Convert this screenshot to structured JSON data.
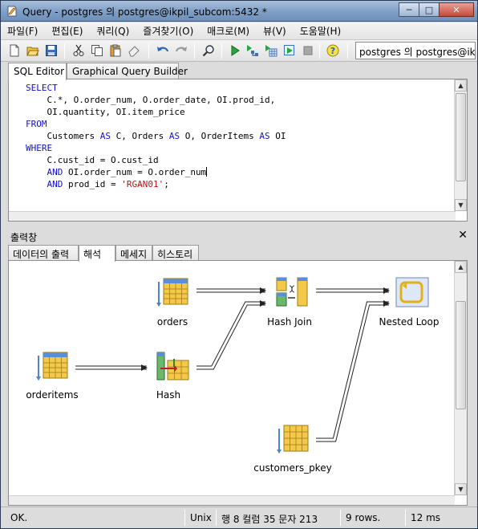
{
  "window": {
    "title": "Query - postgres 의 postgres@ikpil_subcom:5432 *"
  },
  "window_buttons": {
    "minimize": "─",
    "maximize": "□",
    "close": "✕"
  },
  "menu": {
    "items": [
      "파일(F)",
      "편집(E)",
      "쿼리(Q)",
      "즐겨찾기(O)",
      "매크로(M)",
      "뷰(V)",
      "도움말(H)"
    ]
  },
  "toolbar": {
    "connection": "postgres 의 postgres@ikpi"
  },
  "editor_tabs": [
    "SQL Editor",
    "Graphical Query Builder"
  ],
  "sql_lines": [
    [
      {
        "t": "SELECT",
        "k": 1
      }
    ],
    [
      {
        "t": "    C.*, O.order_num, O.order_date, OI.prod_id,",
        "k": 0
      }
    ],
    [
      {
        "t": "    OI.quantity, OI.item_price",
        "k": 0
      }
    ],
    [
      {
        "t": "FROM",
        "k": 1
      }
    ],
    [
      {
        "t": "    Customers ",
        "k": 0
      },
      {
        "t": "AS",
        "k": 1
      },
      {
        "t": " C, Orders ",
        "k": 0
      },
      {
        "t": "AS",
        "k": 1
      },
      {
        "t": " O, OrderItems ",
        "k": 0
      },
      {
        "t": "AS",
        "k": 1
      },
      {
        "t": " OI",
        "k": 0
      }
    ],
    [
      {
        "t": "WHERE",
        "k": 1
      }
    ],
    [
      {
        "t": "    C.cust_id = O.cust_id",
        "k": 0
      }
    ],
    [
      {
        "t": "    ",
        "k": 0
      },
      {
        "t": "AND",
        "k": 1
      },
      {
        "t": " OI.order_num = O.order_num",
        "k": 0
      },
      {
        "t": "|",
        "k": 3
      }
    ],
    [
      {
        "t": "    ",
        "k": 0
      },
      {
        "t": "AND",
        "k": 1
      },
      {
        "t": " prod_id = ",
        "k": 0
      },
      {
        "t": "'RGAN01'",
        "k": 2
      },
      {
        "t": ";",
        "k": 0
      }
    ]
  ],
  "output": {
    "title": "출력창",
    "close": "✕",
    "tabs": [
      "데이터의 출력",
      "해석",
      "메세지",
      "히스토리"
    ],
    "active_tab": 1
  },
  "plan": {
    "nodes": {
      "orders": "orders",
      "hash_join": "Hash Join",
      "nested_loop": "Nested Loop",
      "orderitems": "orderitems",
      "hash": "Hash",
      "customers_pkey": "customers_pkey"
    }
  },
  "status": {
    "message": "OK.",
    "line_ending": "Unix",
    "position": "행 8 컬럼 35 문자 213",
    "rows": "9 rows.",
    "time": "12 ms"
  },
  "colors": {
    "keyword": "#1010c8",
    "string": "#c01010",
    "titlebar": "#7d9ec6"
  }
}
